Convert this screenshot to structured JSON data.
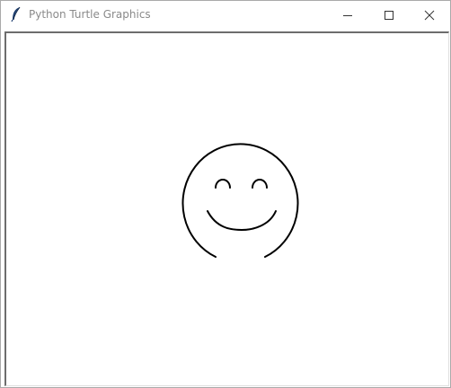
{
  "window": {
    "title": "Python Turtle Graphics",
    "app_icon": "feather-icon"
  },
  "controls": {
    "minimize_icon": "minimize-icon",
    "maximize_icon": "maximize-icon",
    "close_icon": "close-icon"
  },
  "drawing": {
    "stroke_color": "#000000",
    "background_color": "#ffffff",
    "subject": "smiley-face"
  }
}
